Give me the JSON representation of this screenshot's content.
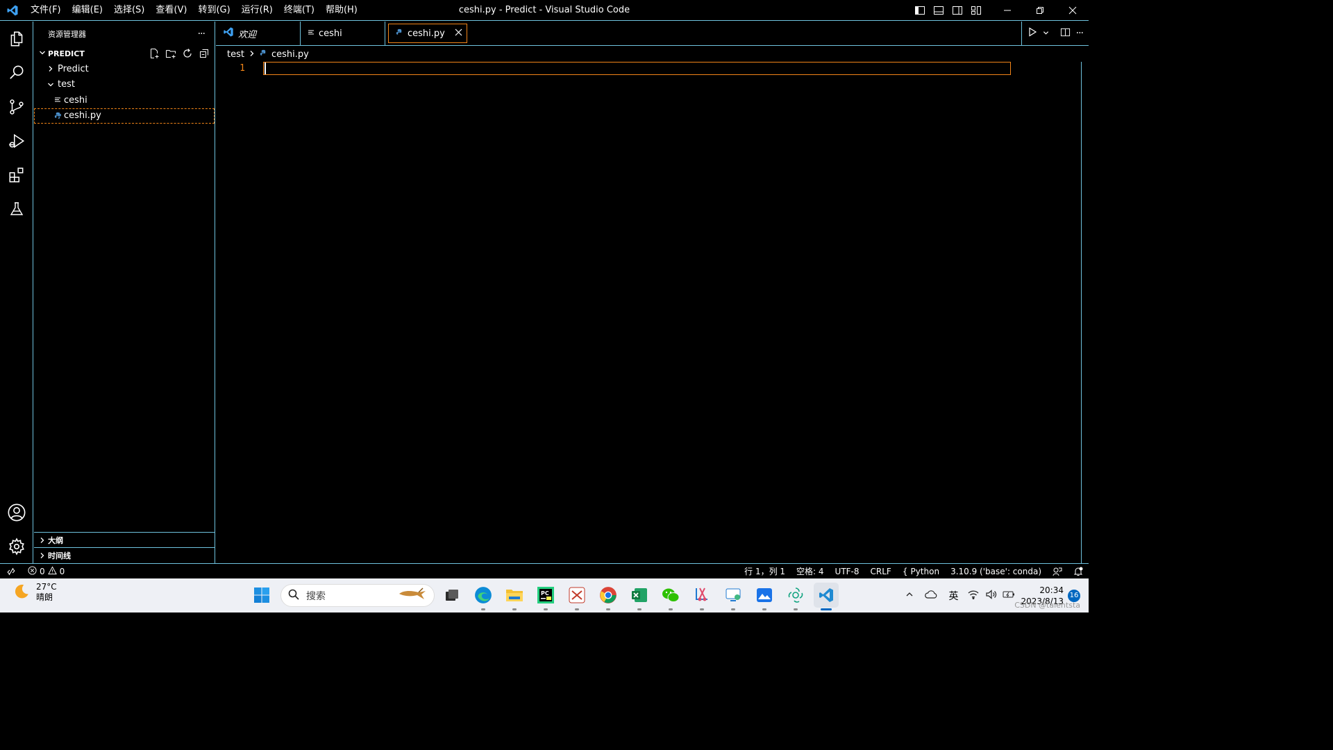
{
  "window": {
    "title": "ceshi.py - Predict - Visual Studio Code",
    "menu": [
      "文件(F)",
      "编辑(E)",
      "选择(S)",
      "查看(V)",
      "转到(G)",
      "运行(R)",
      "终端(T)",
      "帮助(H)"
    ]
  },
  "activity_bar": {
    "items": [
      "explorer-icon",
      "search-icon",
      "source-control-icon",
      "run-debug-icon",
      "extensions-icon",
      "testing-icon"
    ],
    "bottom": [
      "account-icon",
      "settings-gear-icon"
    ]
  },
  "sidebar": {
    "header": "资源管理器",
    "more": "···",
    "section": "PREDICT",
    "tree": [
      {
        "label": "Predict",
        "type": "folder",
        "expanded": false,
        "level": 1
      },
      {
        "label": "test",
        "type": "folder",
        "expanded": true,
        "level": 1
      },
      {
        "label": "ceshi",
        "type": "file",
        "level": 2
      },
      {
        "label": "ceshi.py",
        "type": "python",
        "level": 2,
        "selected": true
      }
    ],
    "outline": "大纲",
    "timeline": "时间线"
  },
  "tabs": [
    {
      "label": "欢迎",
      "icon": "vscode-icon"
    },
    {
      "label": "ceshi",
      "icon": "text-file-icon"
    },
    {
      "label": "ceshi.py",
      "icon": "python-icon",
      "active": true
    }
  ],
  "breadcrumb": {
    "folder": "test",
    "file": "ceshi.py"
  },
  "editor": {
    "line_number": "1"
  },
  "statusbar": {
    "errors": "0",
    "warnings": "0",
    "position": "行 1，列 1",
    "spaces": "空格: 4",
    "encoding": "UTF-8",
    "eol": "CRLF",
    "language": "Python",
    "interpreter": "3.10.9 ('base': conda)"
  },
  "taskbar": {
    "temperature": "27°C",
    "weather": "晴朗",
    "search_placeholder": "搜索",
    "ime": "英",
    "time": "20:34",
    "date": "2023/8/13",
    "notifications": "16",
    "watermark": "CSDN @talentsta"
  },
  "colors": {
    "accent_border": "#6fc3df",
    "focus_border": "#f38518",
    "background": "#000000"
  }
}
